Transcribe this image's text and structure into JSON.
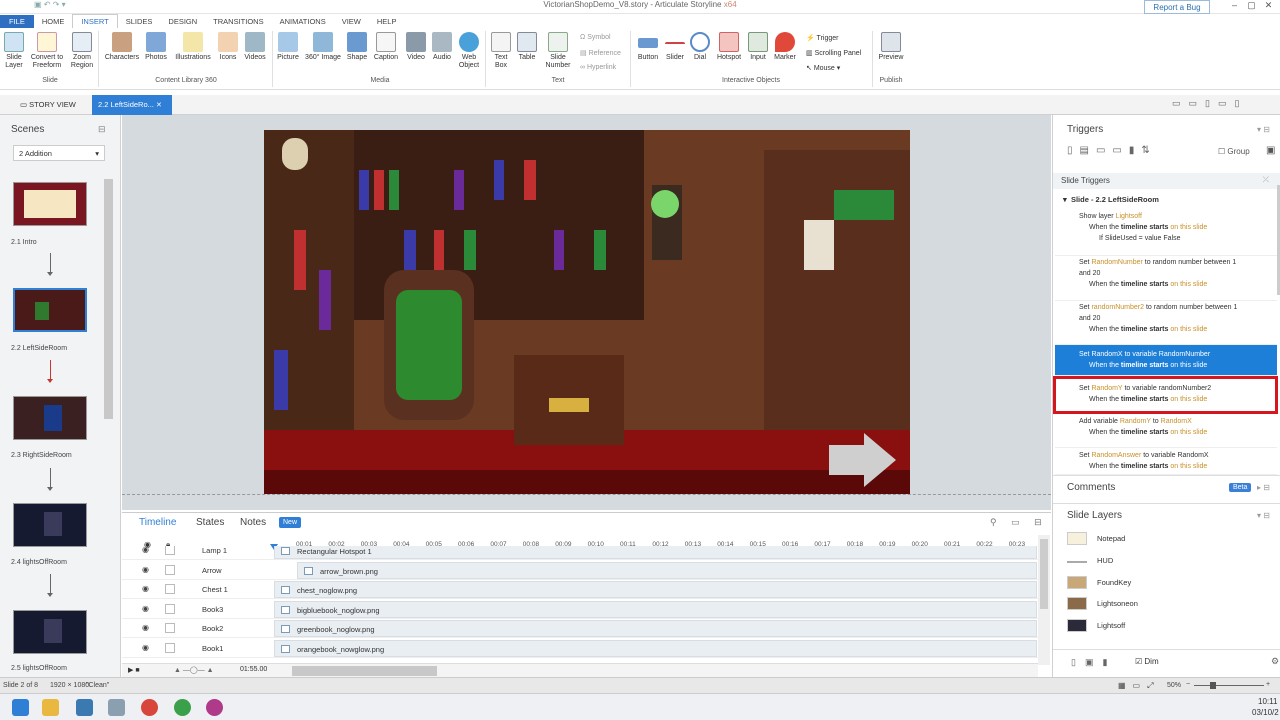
{
  "titlebar": {
    "title": "VictorianShopDemo_V8.story - Articulate Storyline",
    "edition": "x64",
    "report_bug": "Report a Bug"
  },
  "menu_tabs": [
    "FILE",
    "HOME",
    "INSERT",
    "SLIDES",
    "DESIGN",
    "TRANSITIONS",
    "ANIMATIONS",
    "VIEW",
    "HELP"
  ],
  "ribbon": {
    "slide": {
      "items": [
        "Slide Layer",
        "Convert to Freeform",
        "Zoom Region"
      ],
      "group": "Slide"
    },
    "content_library": {
      "items": [
        "Characters",
        "Photos",
        "Illustrations",
        "Icons",
        "Videos"
      ],
      "group": "Content Library 360"
    },
    "media": {
      "items": [
        "Picture",
        "360° Image",
        "Shape",
        "Caption",
        "Video",
        "Audio",
        "Web Object"
      ],
      "group": "Media"
    },
    "text": {
      "items": [
        "Text Box",
        "Table",
        "Slide Number"
      ],
      "small": [
        "Symbol",
        "Reference",
        "Hyperlink"
      ],
      "group": "Text"
    },
    "interactive": {
      "items": [
        "Button",
        "Slider",
        "Dial",
        "Hotspot",
        "Input",
        "Marker"
      ],
      "small": [
        "Trigger",
        "Scrolling Panel",
        "Mouse"
      ],
      "group": "Interactive Objects"
    },
    "publish": {
      "items": [
        "Preview"
      ],
      "group": "Publish"
    }
  },
  "doc_tabs": {
    "story_view": "STORY VIEW",
    "current": "2.2 LeftSideRo..."
  },
  "scenes": {
    "header": "Scenes",
    "selected_scene": "2 Addition",
    "slides": [
      "2.1 Intro",
      "2.2 LeftSideRoom",
      "2.3 RightSideRoom",
      "2.4 lightsOffRoom",
      "2.5 lightsOffRoom"
    ]
  },
  "timeline": {
    "tabs": [
      "Timeline",
      "States",
      "Notes"
    ],
    "new_badge": "New",
    "ticks": [
      "00:01",
      "00:02",
      "00:03",
      "00:04",
      "00:05",
      "00:06",
      "00:07",
      "00:08",
      "00:09",
      "00:10",
      "00:11",
      "00:12",
      "00:13",
      "00:14",
      "00:15",
      "00:16",
      "00:17",
      "00:18",
      "00:19",
      "00:20",
      "00:21",
      "00:22",
      "00:23"
    ],
    "rows": [
      {
        "name": "Lamp 1",
        "file": "Rectangular Hotspot 1"
      },
      {
        "name": "Arrow",
        "file": "arrow_brown.png"
      },
      {
        "name": "Chest 1",
        "file": "chest_noglow.png"
      },
      {
        "name": "Book3",
        "file": "bigbluebook_noglow.png"
      },
      {
        "name": "Book2",
        "file": "greenbook_noglow.png"
      },
      {
        "name": "Book1",
        "file": "orangebook_nowglow.png"
      }
    ],
    "end_time": "01:55.00"
  },
  "triggers": {
    "header": "Triggers",
    "group_label": "Group",
    "section": "Slide Triggers",
    "slide_name": "Slide - 2.2 LeftSideRoom",
    "items": [
      {
        "action": "Show layer",
        "target": "Lightsoff",
        "when": "When the",
        "event": "timeline starts",
        "on": "on this slide",
        "cond": "If SlideUsed = value False"
      },
      {
        "action": "Set",
        "target": "RandomNumber",
        "rest": "to random number between 1",
        "rest2": "and 20",
        "when": "When the",
        "event": "timeline starts",
        "on": "on this slide"
      },
      {
        "action": "Set",
        "target": "randomNumber2",
        "rest": "to random number between 1",
        "rest2": "and 20",
        "when": "When the",
        "event": "timeline starts",
        "on": "on this slide"
      },
      {
        "action": "Set",
        "target": "RandomX",
        "rest": "to variable RandomNumber",
        "when": "When the",
        "event": "timeline starts",
        "on": "on this slide"
      },
      {
        "action": "Set",
        "target": "RandomY",
        "rest": "to variable randomNumber2",
        "when": "When the",
        "event": "timeline starts",
        "on": "on this slide"
      },
      {
        "action": "Add variable",
        "target": "RandomY",
        "rest": "to",
        "target2": "RandomX",
        "when": "When the",
        "event": "timeline starts",
        "on": "on this slide"
      },
      {
        "action": "Set",
        "target": "RandomAnswer",
        "rest": "to variable RandomX",
        "when": "When the",
        "event": "timeline starts",
        "on": "on this slide"
      }
    ]
  },
  "comments": {
    "header": "Comments",
    "badge": "Beta"
  },
  "layers": {
    "header": "Slide Layers",
    "items": [
      "Notepad",
      "HUD",
      "FoundKey",
      "Lightsoneon",
      "Lightsoff"
    ],
    "dim": "Dim"
  },
  "status": {
    "slide": "Slide 2 of 8",
    "size": "1920 × 1080",
    "theme": "\"Clean\"",
    "zoom": "50%"
  },
  "clock": {
    "time": "10:11",
    "date": "03/10/2"
  },
  "colors": {
    "accent": "#2f7fd6",
    "highlight": "#d6161e"
  }
}
